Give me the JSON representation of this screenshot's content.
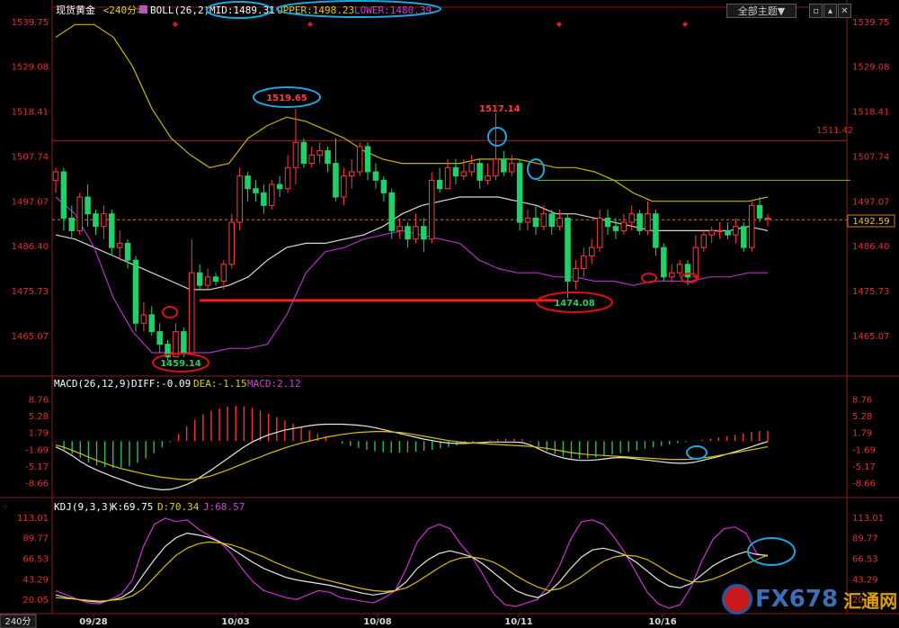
{
  "header": {
    "symbol": "现货黄金",
    "period": "<240分>",
    "indicator": "BOLL(26,2)",
    "mid": "MID:1489.31",
    "upper": "UPPER:1498.23",
    "lower": "LOWER:1480.39",
    "theme_button": "全部主题▼",
    "period_tab": "240分"
  },
  "price_axis": [
    "1539.75",
    "1529.08",
    "1518.41",
    "1507.74",
    "1497.07",
    "1486.40",
    "1475.73",
    "1465.07"
  ],
  "current_price": "1492.59",
  "macd": {
    "title": "MACD(26,12,9)",
    "diff": "DIFF:-0.09",
    "dea": "DEA:-1.15",
    "macd": "MACD:2.12",
    "axis": [
      "8.76",
      "5.28",
      "1.79",
      "-1.69",
      "-5.17",
      "-8.66"
    ]
  },
  "kdj": {
    "title": "KDJ(9,3,3)",
    "k": "K:69.75",
    "d": "D:70.34",
    "j": "J:68.57",
    "axis": [
      "113.01",
      "89.77",
      "66.53",
      "43.29",
      "20.05"
    ]
  },
  "dates": [
    "09/28",
    "10/03",
    "10/08",
    "10/11",
    "10/16"
  ],
  "annotations": {
    "high1": "1519.65",
    "high2": "1517.14",
    "low1": "1459.14",
    "low2": "1474.08",
    "resistance": "1511.42"
  },
  "watermark": {
    "text": "FX678",
    "cn": "汇通网"
  },
  "chart_data": {
    "type": "candlestick",
    "price_range": [
      1458,
      1541
    ],
    "candles": [
      {
        "o": 1502,
        "c": 1504,
        "h": 1505,
        "l": 1499
      },
      {
        "o": 1504,
        "c": 1493,
        "h": 1505,
        "l": 1490
      },
      {
        "o": 1493,
        "c": 1490,
        "h": 1496,
        "l": 1488
      },
      {
        "o": 1490,
        "c": 1498,
        "h": 1499,
        "l": 1489
      },
      {
        "o": 1498,
        "c": 1494,
        "h": 1501,
        "l": 1491
      },
      {
        "o": 1494,
        "c": 1491,
        "h": 1495,
        "l": 1489
      },
      {
        "o": 1491,
        "c": 1494,
        "h": 1496,
        "l": 1488
      },
      {
        "o": 1494,
        "c": 1486,
        "h": 1495,
        "l": 1484
      },
      {
        "o": 1486,
        "c": 1487,
        "h": 1490,
        "l": 1483
      },
      {
        "o": 1487,
        "c": 1483,
        "h": 1488,
        "l": 1481
      },
      {
        "o": 1483,
        "c": 1468,
        "h": 1484,
        "l": 1466
      },
      {
        "o": 1468,
        "c": 1470,
        "h": 1473,
        "l": 1466
      },
      {
        "o": 1470,
        "c": 1466,
        "h": 1472,
        "l": 1465
      },
      {
        "o": 1466,
        "c": 1463,
        "h": 1468,
        "l": 1461
      },
      {
        "o": 1463,
        "c": 1460,
        "h": 1464,
        "l": 1459
      },
      {
        "o": 1460,
        "c": 1466,
        "h": 1468,
        "l": 1460
      },
      {
        "o": 1466,
        "c": 1461,
        "h": 1467,
        "l": 1460
      },
      {
        "o": 1461,
        "c": 1480,
        "h": 1488,
        "l": 1461
      },
      {
        "o": 1480,
        "c": 1477,
        "h": 1482,
        "l": 1476
      },
      {
        "o": 1477,
        "c": 1479,
        "h": 1481,
        "l": 1476
      },
      {
        "o": 1479,
        "c": 1478,
        "h": 1480,
        "l": 1477
      },
      {
        "o": 1478,
        "c": 1482,
        "h": 1483,
        "l": 1476
      },
      {
        "o": 1482,
        "c": 1492,
        "h": 1494,
        "l": 1481
      },
      {
        "o": 1492,
        "c": 1503,
        "h": 1505,
        "l": 1490
      },
      {
        "o": 1503,
        "c": 1500,
        "h": 1504,
        "l": 1497
      },
      {
        "o": 1500,
        "c": 1499,
        "h": 1502,
        "l": 1497
      },
      {
        "o": 1499,
        "c": 1496,
        "h": 1501,
        "l": 1494
      },
      {
        "o": 1496,
        "c": 1501,
        "h": 1502,
        "l": 1495
      },
      {
        "o": 1501,
        "c": 1500,
        "h": 1503,
        "l": 1498
      },
      {
        "o": 1500,
        "c": 1505,
        "h": 1508,
        "l": 1499
      },
      {
        "o": 1505,
        "c": 1511,
        "h": 1519,
        "l": 1501
      },
      {
        "o": 1511,
        "c": 1506,
        "h": 1512,
        "l": 1505
      },
      {
        "o": 1506,
        "c": 1508,
        "h": 1510,
        "l": 1505
      },
      {
        "o": 1508,
        "c": 1509,
        "h": 1511,
        "l": 1506
      },
      {
        "o": 1509,
        "c": 1506,
        "h": 1510,
        "l": 1504
      },
      {
        "o": 1506,
        "c": 1498,
        "h": 1512,
        "l": 1497
      },
      {
        "o": 1498,
        "c": 1503,
        "h": 1505,
        "l": 1496
      },
      {
        "o": 1503,
        "c": 1504,
        "h": 1507,
        "l": 1500
      },
      {
        "o": 1504,
        "c": 1510,
        "h": 1511,
        "l": 1503
      },
      {
        "o": 1510,
        "c": 1504,
        "h": 1511,
        "l": 1502
      },
      {
        "o": 1504,
        "c": 1502,
        "h": 1506,
        "l": 1500
      },
      {
        "o": 1502,
        "c": 1499,
        "h": 1503,
        "l": 1497
      },
      {
        "o": 1499,
        "c": 1490,
        "h": 1500,
        "l": 1488
      },
      {
        "o": 1490,
        "c": 1491,
        "h": 1493,
        "l": 1488
      },
      {
        "o": 1491,
        "c": 1488,
        "h": 1492,
        "l": 1486
      },
      {
        "o": 1488,
        "c": 1491,
        "h": 1494,
        "l": 1487
      },
      {
        "o": 1491,
        "c": 1488,
        "h": 1493,
        "l": 1485
      },
      {
        "o": 1488,
        "c": 1502,
        "h": 1504,
        "l": 1487
      },
      {
        "o": 1502,
        "c": 1500,
        "h": 1505,
        "l": 1499
      },
      {
        "o": 1500,
        "c": 1505,
        "h": 1507,
        "l": 1500
      },
      {
        "o": 1505,
        "c": 1503,
        "h": 1507,
        "l": 1501
      },
      {
        "o": 1503,
        "c": 1504,
        "h": 1507,
        "l": 1502
      },
      {
        "o": 1504,
        "c": 1506,
        "h": 1508,
        "l": 1503
      },
      {
        "o": 1506,
        "c": 1502,
        "h": 1507,
        "l": 1500
      },
      {
        "o": 1502,
        "c": 1503,
        "h": 1506,
        "l": 1501
      },
      {
        "o": 1503,
        "c": 1507,
        "h": 1518,
        "l": 1502
      },
      {
        "o": 1507,
        "c": 1504,
        "h": 1509,
        "l": 1503
      },
      {
        "o": 1504,
        "c": 1506,
        "h": 1508,
        "l": 1503
      },
      {
        "o": 1506,
        "c": 1492,
        "h": 1507,
        "l": 1490
      },
      {
        "o": 1492,
        "c": 1493,
        "h": 1495,
        "l": 1490
      },
      {
        "o": 1493,
        "c": 1491,
        "h": 1496,
        "l": 1489
      },
      {
        "o": 1491,
        "c": 1494,
        "h": 1496,
        "l": 1490
      },
      {
        "o": 1494,
        "c": 1491,
        "h": 1495,
        "l": 1489
      },
      {
        "o": 1491,
        "c": 1493,
        "h": 1495,
        "l": 1490
      },
      {
        "o": 1493,
        "c": 1478,
        "h": 1494,
        "l": 1474
      },
      {
        "o": 1478,
        "c": 1481,
        "h": 1483,
        "l": 1476
      },
      {
        "o": 1481,
        "c": 1484,
        "h": 1486,
        "l": 1479
      },
      {
        "o": 1484,
        "c": 1486,
        "h": 1488,
        "l": 1482
      },
      {
        "o": 1486,
        "c": 1493,
        "h": 1495,
        "l": 1485
      },
      {
        "o": 1493,
        "c": 1491,
        "h": 1495,
        "l": 1489
      },
      {
        "o": 1491,
        "c": 1490,
        "h": 1493,
        "l": 1488
      },
      {
        "o": 1490,
        "c": 1492,
        "h": 1494,
        "l": 1489
      },
      {
        "o": 1492,
        "c": 1494,
        "h": 1496,
        "l": 1490
      },
      {
        "o": 1494,
        "c": 1490,
        "h": 1495,
        "l": 1489
      },
      {
        "o": 1490,
        "c": 1494,
        "h": 1497,
        "l": 1489
      },
      {
        "o": 1494,
        "c": 1486,
        "h": 1495,
        "l": 1484
      },
      {
        "o": 1486,
        "c": 1479,
        "h": 1487,
        "l": 1478
      },
      {
        "o": 1479,
        "c": 1480,
        "h": 1482,
        "l": 1478
      },
      {
        "o": 1480,
        "c": 1482,
        "h": 1483,
        "l": 1479
      },
      {
        "o": 1482,
        "c": 1479,
        "h": 1483,
        "l": 1477
      },
      {
        "o": 1479,
        "c": 1486,
        "h": 1489,
        "l": 1478
      },
      {
        "o": 1486,
        "c": 1489,
        "h": 1490,
        "l": 1485
      },
      {
        "o": 1489,
        "c": 1490,
        "h": 1491,
        "l": 1487
      },
      {
        "o": 1490,
        "c": 1490,
        "h": 1492,
        "l": 1488
      },
      {
        "o": 1490,
        "c": 1489,
        "h": 1492,
        "l": 1488
      },
      {
        "o": 1489,
        "c": 1491,
        "h": 1493,
        "l": 1487
      },
      {
        "o": 1491,
        "c": 1486,
        "h": 1492,
        "l": 1485
      },
      {
        "o": 1486,
        "c": 1496,
        "h": 1497,
        "l": 1485
      },
      {
        "o": 1496,
        "c": 1493,
        "h": 1498,
        "l": 1492
      },
      {
        "o": 1493,
        "c": 1493,
        "h": 1494,
        "l": 1491
      }
    ],
    "boll_mid": [
      1489,
      1488,
      1486,
      1484,
      1482,
      1480,
      1478,
      1476,
      1476,
      1477,
      1479,
      1483,
      1486,
      1487,
      1487,
      1488,
      1489,
      1491,
      1494,
      1496,
      1497,
      1498,
      1498,
      1498,
      1497,
      1496,
      1494,
      1494,
      1493,
      1492,
      1491,
      1490,
      1490,
      1490,
      1490,
      1490,
      1491,
      1490
    ],
    "boll_upper": [
      1536,
      1539,
      1539,
      1536,
      1529,
      1519,
      1512,
      1508,
      1505,
      1506,
      1512,
      1515,
      1517,
      1516,
      1514,
      1512,
      1509,
      1507,
      1506,
      1506,
      1506,
      1506,
      1507,
      1507,
      1507,
      1506,
      1505,
      1505,
      1504,
      1502,
      1499,
      1497,
      1497,
      1497,
      1497,
      1497,
      1497,
      1498
    ],
    "boll_lower": [
      1498,
      1494,
      1486,
      1474,
      1466,
      1461,
      1461,
      1461,
      1461,
      1462,
      1462,
      1463,
      1470,
      1480,
      1485,
      1486,
      1488,
      1489,
      1490,
      1489,
      1488,
      1487,
      1483,
      1481,
      1480,
      1480,
      1479,
      1479,
      1478,
      1478,
      1477,
      1478,
      1478,
      1478,
      1479,
      1479,
      1480,
      1480
    ],
    "resistance_level": 1511.42,
    "support_level": 1474.08,
    "macd_range": [
      -10.4,
      10.5
    ],
    "macd_hist": [
      -0.1,
      -1.8,
      -2.6,
      -3.5,
      -4.4,
      -5.0,
      -5.4,
      -5.6,
      -5.5,
      -5.2,
      -4.5,
      -3.6,
      -2.5,
      -1.3,
      -0.2,
      1.5,
      3.0,
      4.4,
      5.6,
      6.3,
      6.8,
      7.2,
      7.3,
      7.2,
      6.9,
      6.3,
      5.7,
      5.0,
      4.3,
      3.6,
      2.9,
      2.2,
      1.5,
      0.8,
      0.1,
      -0.5,
      -1.0,
      -1.4,
      -1.8,
      -2.1,
      -2.3,
      -2.4,
      -2.4,
      -2.3,
      -2.2,
      -2.0,
      -1.8,
      -1.5,
      -1.2,
      -0.9,
      -0.6,
      -0.3,
      0.0,
      0.2,
      0.4,
      0.5,
      0.5,
      0.4,
      -0.2,
      -1.1,
      -2.0,
      -2.7,
      -3.2,
      -3.6,
      -3.7,
      -3.6,
      -3.4,
      -3.1,
      -2.8,
      -2.5,
      -2.2,
      -1.9,
      -1.6,
      -1.3,
      -1.0,
      -0.7,
      -0.4,
      -0.2,
      0.1,
      0.3,
      0.5,
      0.8,
      1.0,
      1.3,
      1.6,
      1.9,
      2.1,
      2.12
    ],
    "macd_diff": [
      -1.2,
      -2.0,
      -3.0,
      -4.2,
      -5.2,
      -6.0,
      -6.7,
      -7.4,
      -8.0,
      -8.6,
      -9.2,
      -9.6,
      -9.9,
      -10.1,
      -10.0,
      -9.6,
      -9.0,
      -8.2,
      -7.1,
      -6.0,
      -4.8,
      -3.6,
      -2.4,
      -1.2,
      -0.2,
      0.6,
      1.3,
      1.8,
      2.3,
      2.6,
      2.9,
      3.2,
      3.4,
      3.5,
      3.5,
      3.5,
      3.4,
      3.3,
      3.1,
      2.8,
      2.4,
      2.0,
      1.6,
      1.2,
      0.8,
      0.4,
      0.1,
      -0.2,
      -0.4,
      -0.5,
      -0.5,
      -0.4,
      -0.3,
      -0.2,
      -0.2,
      -0.2,
      -0.2,
      -0.3,
      -0.8,
      -1.6,
      -2.4,
      -3.0,
      -3.5,
      -3.8,
      -4.0,
      -4.0,
      -3.9,
      -3.7,
      -3.5,
      -3.4,
      -3.5,
      -3.7,
      -3.9,
      -4.1,
      -4.3,
      -4.5,
      -4.6,
      -4.6,
      -4.4,
      -4.0,
      -3.6,
      -3.2,
      -2.7,
      -2.2,
      -1.7,
      -1.2,
      -0.6,
      -0.09
    ],
    "macd_dea": [
      -0.8,
      -1.3,
      -1.9,
      -2.6,
      -3.3,
      -4.0,
      -4.6,
      -5.2,
      -5.7,
      -6.1,
      -6.5,
      -6.9,
      -7.2,
      -7.5,
      -7.7,
      -7.9,
      -8.0,
      -7.9,
      -7.6,
      -7.2,
      -6.6,
      -6.0,
      -5.3,
      -4.6,
      -3.9,
      -3.3,
      -2.6,
      -2.0,
      -1.4,
      -0.9,
      -0.4,
      0.0,
      0.4,
      0.8,
      1.1,
      1.4,
      1.6,
      1.8,
      1.9,
      2.0,
      2.0,
      1.9,
      1.8,
      1.6,
      1.3,
      1.0,
      0.7,
      0.4,
      0.1,
      -0.1,
      -0.3,
      -0.4,
      -0.5,
      -0.6,
      -0.7,
      -0.8,
      -0.9,
      -1.0,
      -1.1,
      -1.3,
      -1.5,
      -1.8,
      -2.1,
      -2.4,
      -2.6,
      -2.8,
      -2.9,
      -3.0,
      -3.1,
      -3.2,
      -3.3,
      -3.4,
      -3.5,
      -3.6,
      -3.7,
      -3.8,
      -3.8,
      -3.8,
      -3.7,
      -3.5,
      -3.3,
      -3.0,
      -2.7,
      -2.4,
      -2.1,
      -1.8,
      -1.5,
      -1.15
    ],
    "kdj_range": [
      10,
      116
    ],
    "kdj_k": [
      25,
      22,
      20,
      18,
      17,
      19,
      22,
      30,
      48,
      65,
      80,
      90,
      95,
      93,
      90,
      85,
      78,
      70,
      62,
      55,
      50,
      45,
      42,
      40,
      38,
      36,
      33,
      30,
      27,
      25,
      27,
      30,
      40,
      55,
      65,
      72,
      75,
      72,
      68,
      60,
      50,
      40,
      30,
      25,
      22,
      28,
      40,
      55,
      68,
      76,
      78,
      75,
      70,
      62,
      52,
      42,
      35,
      33,
      38,
      48,
      58,
      65,
      70,
      74,
      70.8,
      69.75
    ],
    "kdj_d": [
      22,
      21,
      20,
      19,
      18,
      19,
      20,
      24,
      32,
      45,
      58,
      70,
      78,
      83,
      85,
      84,
      82,
      78,
      73,
      68,
      62,
      57,
      52,
      48,
      44,
      41,
      38,
      35,
      32,
      30,
      29,
      30,
      33,
      40,
      48,
      56,
      63,
      67,
      68,
      66,
      62,
      55,
      47,
      40,
      34,
      30,
      32,
      38,
      46,
      55,
      63,
      68,
      70,
      69,
      65,
      58,
      50,
      44,
      40,
      40,
      43,
      48,
      54,
      60,
      65,
      70.34
    ],
    "kdj_j": [
      30,
      25,
      20,
      16,
      15,
      20,
      26,
      42,
      80,
      105,
      112,
      108,
      110,
      100,
      92,
      85,
      72,
      55,
      40,
      30,
      26,
      22,
      20,
      25,
      30,
      28,
      22,
      20,
      18,
      16,
      22,
      30,
      55,
      85,
      100,
      105,
      100,
      82,
      68,
      48,
      26,
      14,
      12,
      16,
      20,
      36,
      58,
      88,
      108,
      110,
      105,
      90,
      72,
      50,
      28,
      15,
      10,
      14,
      34,
      64,
      88,
      100,
      102,
      95,
      72,
      68.57
    ]
  }
}
